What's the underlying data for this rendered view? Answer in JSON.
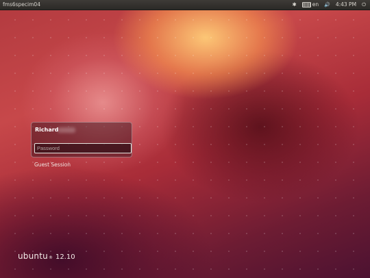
{
  "top_panel": {
    "hostname": "fms6specim04",
    "indicators": [
      {
        "name": "accessibility-icon",
        "glyph": "✱"
      },
      {
        "name": "keyboard-layout",
        "label": "en"
      },
      {
        "name": "volume-icon",
        "glyph": "🔊"
      },
      {
        "name": "clock",
        "label": "4:43 PM"
      },
      {
        "name": "power-icon",
        "glyph": "⏻"
      }
    ]
  },
  "login": {
    "user_name": "Richard",
    "password_placeholder": "Password",
    "guest_label": "Guest Session"
  },
  "brand": {
    "name": "ubuntu",
    "mark": "®",
    "version": "12.10"
  },
  "colors": {
    "panel": "#2b2926",
    "accent": "#e95420",
    "background_dark": "#4c1231"
  }
}
